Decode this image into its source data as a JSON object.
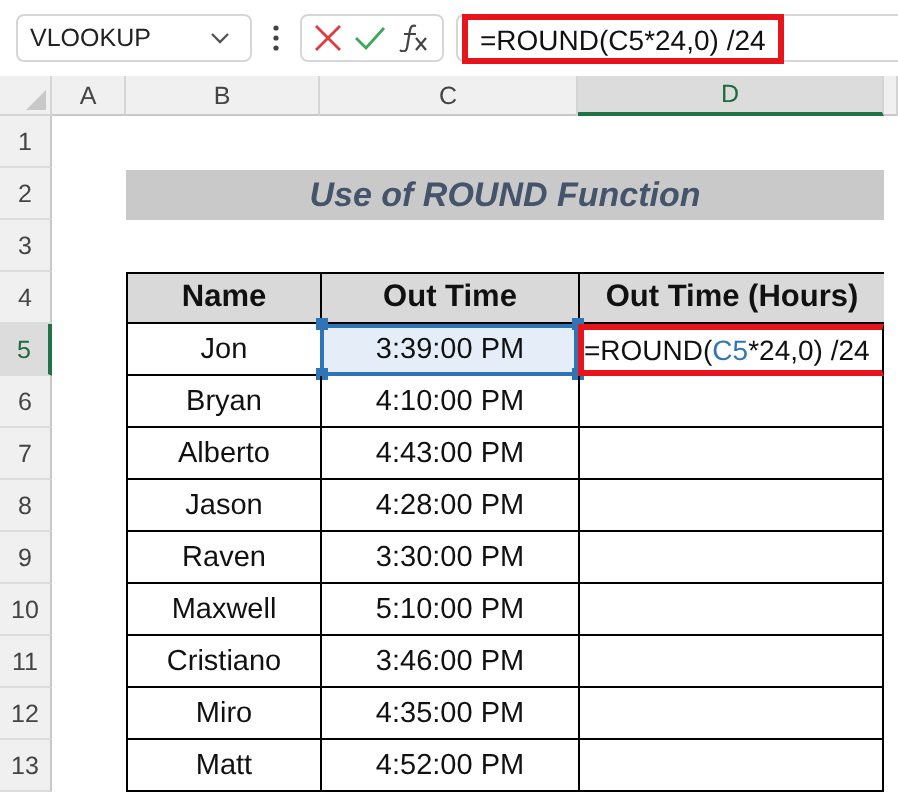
{
  "name_box": "VLOOKUP",
  "formula_bar": {
    "formula": "=ROUND(C5*24,0) /24",
    "highlighted": true
  },
  "columns": [
    {
      "label": "A",
      "selected": false
    },
    {
      "label": "B",
      "selected": false
    },
    {
      "label": "C",
      "selected": false
    },
    {
      "label": "D",
      "selected": true
    }
  ],
  "rows": [
    {
      "label": "1",
      "selected": false
    },
    {
      "label": "2",
      "selected": false
    },
    {
      "label": "3",
      "selected": false
    },
    {
      "label": "4",
      "selected": false
    },
    {
      "label": "5",
      "selected": true
    },
    {
      "label": "6",
      "selected": false
    },
    {
      "label": "7",
      "selected": false
    },
    {
      "label": "8",
      "selected": false
    },
    {
      "label": "9",
      "selected": false
    },
    {
      "label": "10",
      "selected": false
    },
    {
      "label": "11",
      "selected": false
    },
    {
      "label": "12",
      "selected": false
    },
    {
      "label": "13",
      "selected": false
    }
  ],
  "title": "Use of ROUND Function",
  "table": {
    "columns": [
      "Name",
      "Out Time",
      "Out Time (Hours)"
    ],
    "rows": [
      {
        "name": "Jon",
        "out_time": "3:39:00 PM",
        "time_referenced": true,
        "hours_highlighted": true,
        "hours": [
          {
            "text": "=ROUND(",
            "kind": "plain"
          },
          {
            "text": "C5",
            "kind": "reference"
          },
          {
            "text": "*24,0) /24",
            "kind": "plain"
          }
        ]
      },
      {
        "name": "Bryan",
        "out_time": "4:10:00 PM",
        "time_referenced": false,
        "hours_highlighted": false
      },
      {
        "name": "Alberto",
        "out_time": "4:43:00 PM",
        "time_referenced": false,
        "hours_highlighted": false
      },
      {
        "name": "Jason",
        "out_time": "4:28:00 PM",
        "time_referenced": false,
        "hours_highlighted": false
      },
      {
        "name": "Raven",
        "out_time": "3:30:00 PM",
        "time_referenced": false,
        "hours_highlighted": false
      },
      {
        "name": "Maxwell",
        "out_time": "5:10:00 PM",
        "time_referenced": false,
        "hours_highlighted": false
      },
      {
        "name": "Cristiano",
        "out_time": "3:46:00 PM",
        "time_referenced": false,
        "hours_highlighted": false
      },
      {
        "name": "Miro",
        "out_time": "4:35:00 PM",
        "time_referenced": false,
        "hours_highlighted": false
      },
      {
        "name": "Matt",
        "out_time": "4:52:00 PM",
        "time_referenced": false,
        "hours_highlighted": false
      }
    ]
  }
}
